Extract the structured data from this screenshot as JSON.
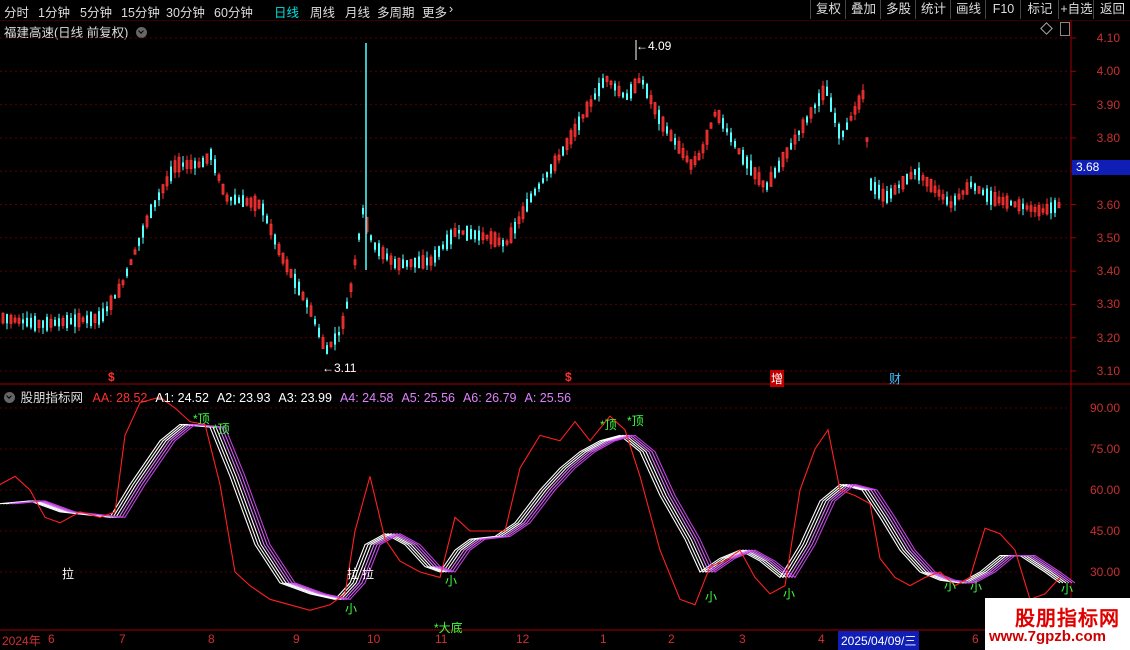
{
  "toolbar": {
    "periods": [
      "分时",
      "1分钟",
      "5分钟",
      "15分钟",
      "30分钟",
      "60分钟",
      "日线",
      "周线",
      "月线",
      "多周期"
    ],
    "active_period": "日线",
    "more": "更多",
    "buttons": [
      "复权",
      "叠加",
      "多股",
      "统计",
      "画线",
      "F10",
      "标记",
      "+自选",
      "返回"
    ]
  },
  "price_panel": {
    "title": "福建高速(日线 前复权)",
    "y_ticks": [
      "4.10",
      "4.00",
      "3.90",
      "3.80",
      "3.70",
      "3.60",
      "3.50",
      "3.40",
      "3.30",
      "3.20",
      "3.10"
    ],
    "current_price": "3.68",
    "high_label": "4.09",
    "low_label": "3.11",
    "markers": [
      {
        "text": "$",
        "color": "#ff3030"
      },
      {
        "text": "$",
        "color": "#ff3030"
      },
      {
        "text": "增",
        "color": "#ffffff",
        "bg": "#c00000"
      },
      {
        "text": "财",
        "color": "#40c0ff"
      }
    ]
  },
  "indicator_panel": {
    "title": "股朋指标网",
    "values": [
      {
        "name": "AA",
        "value": "28.52",
        "color": "#ff3030"
      },
      {
        "name": "A1",
        "value": "24.52",
        "color": "#ffffff"
      },
      {
        "name": "A2",
        "value": "23.93",
        "color": "#ffffff"
      },
      {
        "name": "A3",
        "value": "23.99",
        "color": "#ffffff"
      },
      {
        "name": "A4",
        "value": "24.58",
        "color": "#e080ff"
      },
      {
        "name": "A5",
        "value": "25.56",
        "color": "#e080ff"
      },
      {
        "name": "A6",
        "value": "26.79",
        "color": "#e080ff"
      },
      {
        "name": "A",
        "value": "25.56",
        "color": "#e080ff"
      }
    ],
    "y_ticks": [
      "90.00",
      "75.00",
      "60.00",
      "45.00",
      "30.00"
    ],
    "signals": {
      "top1": "*顶",
      "top2": "*顶",
      "top3": "*顶",
      "top4": "*顶",
      "la1": "拉",
      "la2": "拉",
      "la3": "拉",
      "small": "小",
      "bigbottom": "*大底"
    }
  },
  "date_axis": {
    "labels": [
      "2024年",
      "6",
      "7",
      "8",
      "9",
      "10",
      "11",
      "12",
      "1",
      "2",
      "3",
      "4",
      "6"
    ],
    "current_date": "2025/04/09/三"
  },
  "watermark": {
    "title": "股朋指标网",
    "url": "www.7gpzb.com"
  }
}
